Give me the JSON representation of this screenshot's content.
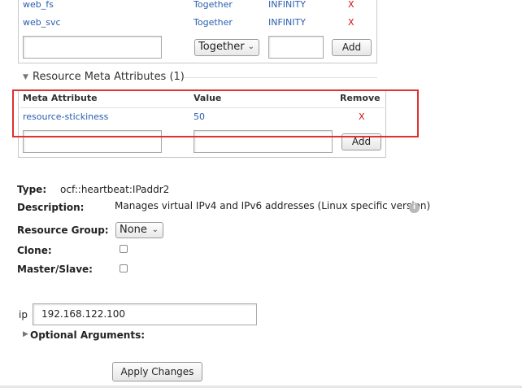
{
  "colocation": {
    "rows": [
      {
        "resource": "web_fs",
        "mode": "Together",
        "score": "INFINITY",
        "remove": "X"
      },
      {
        "resource": "web_svc",
        "mode": "Together",
        "score": "INFINITY",
        "remove": "X"
      }
    ],
    "new_resource_value": "",
    "mode_select": "Together",
    "new_score_value": "",
    "add_label": "Add"
  },
  "meta": {
    "section_title": "Resource Meta Attributes (1)",
    "headers": {
      "attribute": "Meta Attribute",
      "value": "Value",
      "remove": "Remove"
    },
    "rows": [
      {
        "attribute": "resource-stickiness",
        "value": "50",
        "remove": "X"
      }
    ],
    "new_attribute_value": "",
    "new_value_value": "",
    "add_label": "Add"
  },
  "details": {
    "type_label": "Type:",
    "type_value": "ocf::heartbeat:IPaddr2",
    "description_label": "Description:",
    "description_value": "Manages virtual IPv4 and IPv6 addresses (Linux specific version)",
    "group_label": "Resource Group:",
    "group_select": "None",
    "clone_label": "Clone:",
    "clone_checked": false,
    "master_label": "Master/Slave:",
    "master_checked": false
  },
  "params": {
    "ip_label": "ip",
    "ip_value": "192.168.122.100",
    "optional_label": "Optional Arguments:",
    "apply_label": "Apply Changes"
  },
  "colors": {
    "link": "#2a5db0",
    "remove": "#d01010",
    "highlight": "#e03030"
  }
}
